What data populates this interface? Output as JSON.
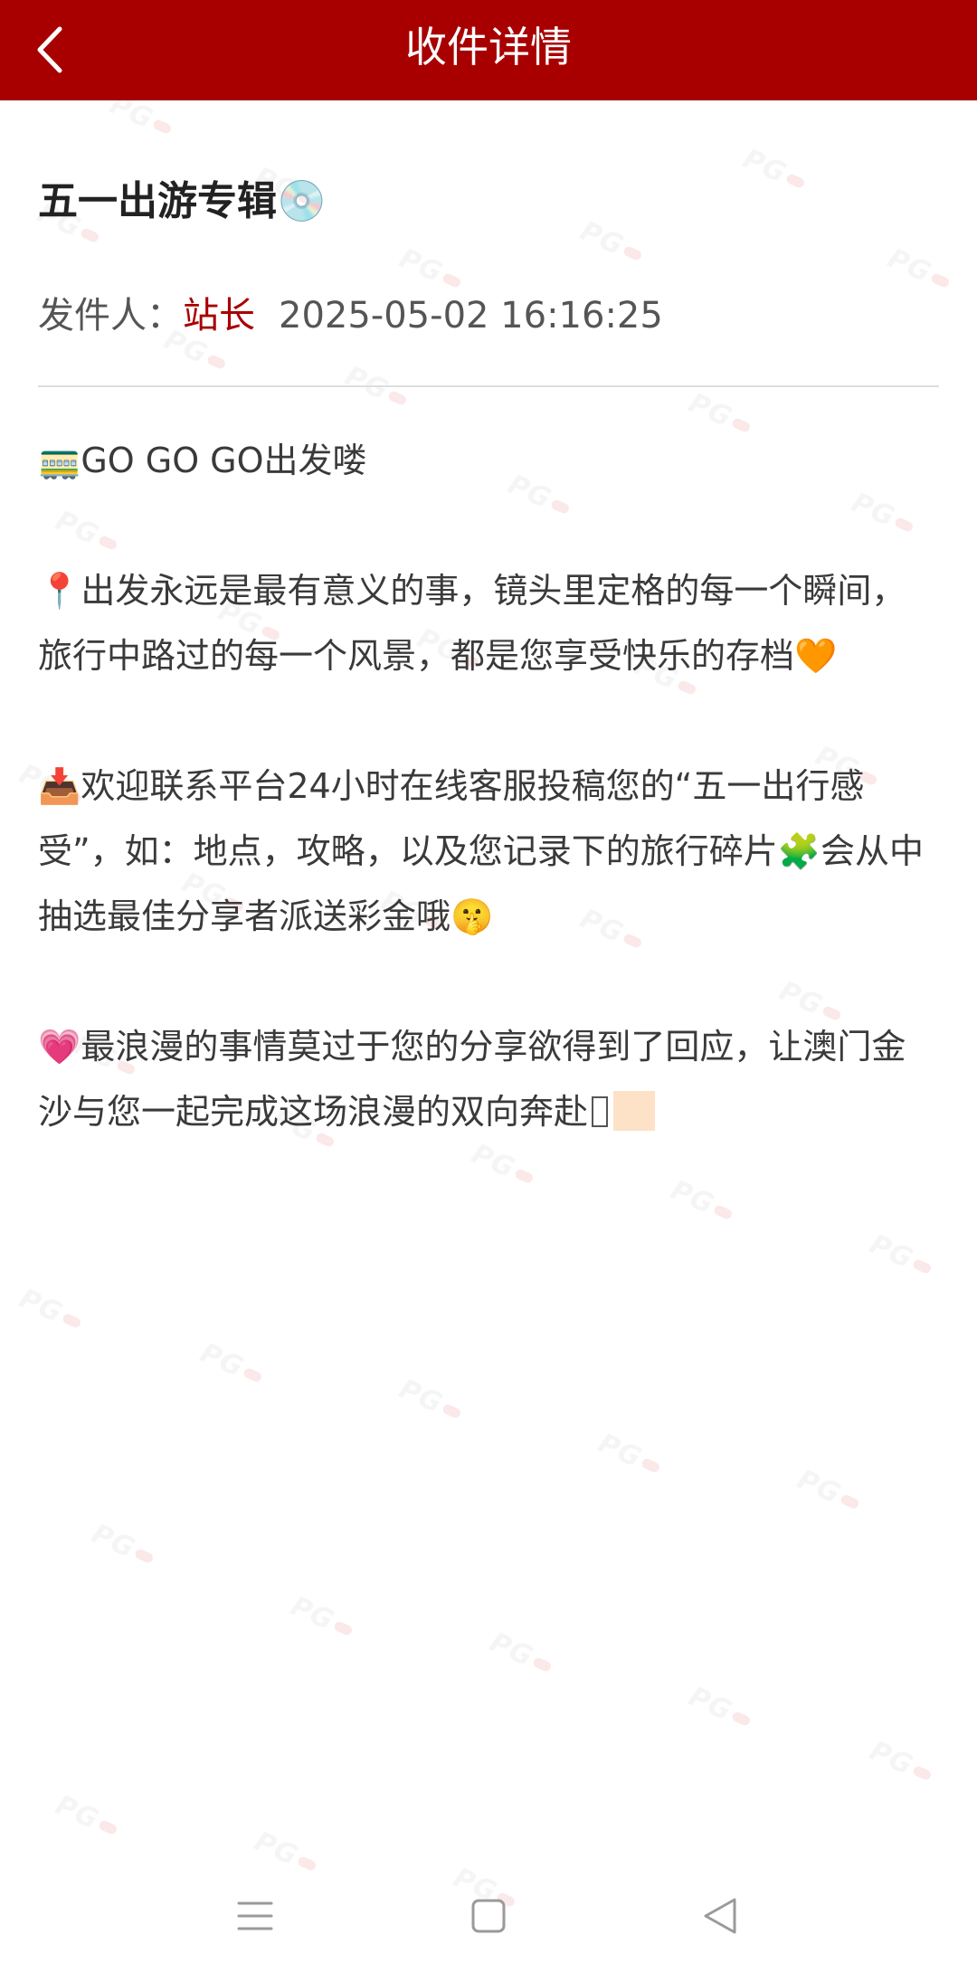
{
  "header": {
    "title": "收件详情",
    "background_color": "#a80000",
    "back_icon": "chevron-left-icon"
  },
  "message": {
    "title": "五一出游专辑💿",
    "sender_label": "发件人：",
    "sender_name": "站长",
    "sender_color": "#a80000",
    "time": "2025-05-02 16:16:25",
    "paragraphs": [
      "🚃GO GO GO出发喽",
      "📍出发永远是最有意义的事，镜头里定格的每一个瞬间，旅行中路过的每一个风景，都是您享受快乐的存档🧡",
      "📥欢迎联系平台24小时在线客服投稿您的“五一出行感受”，如：地点，攻略，以及您记录下的旅行碎片🧩会从中抽选最佳分享者派送彩金哦🤫",
      "💗最浪漫的事情莫过于您的分享欲得到了回应，让澳门金沙与您一起完成这场浪漫的双向奔赴"
    ]
  },
  "nav": {
    "menu_icon": "menu-icon",
    "home_icon": "square-home-icon",
    "back_icon": "triangle-back-icon"
  }
}
